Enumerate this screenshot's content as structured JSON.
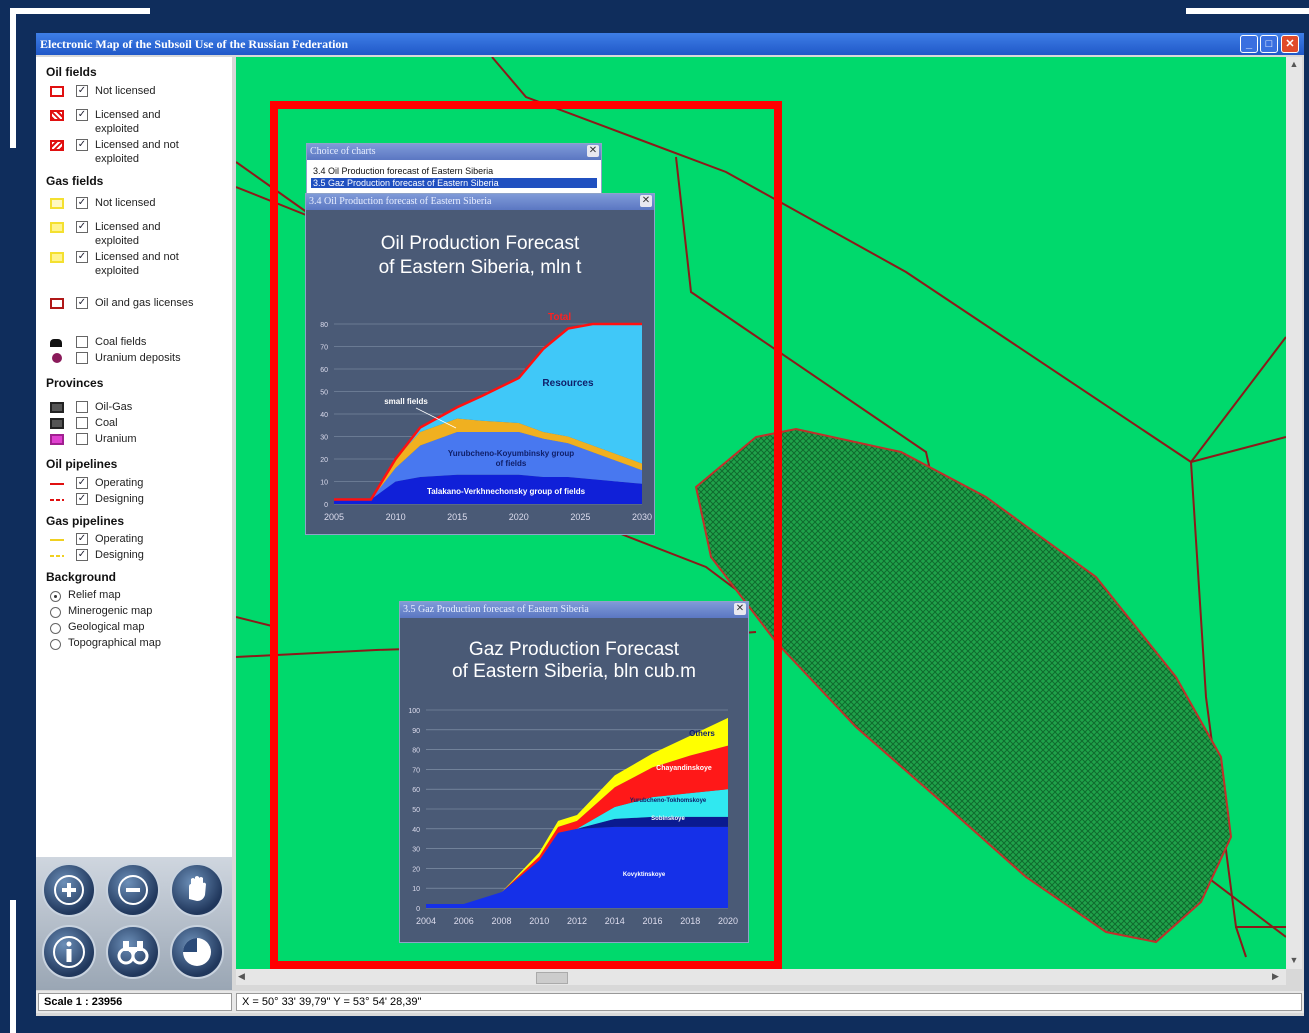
{
  "window": {
    "title": "Electronic Map of the Subsoil Use of the Russian Federation"
  },
  "legend": {
    "oil_fields": {
      "title": "Oil fields",
      "items": [
        "Not licensed",
        "Licensed  and exploited",
        "Licensed  and not exploited"
      ]
    },
    "gas_fields": {
      "title": "Gas fields",
      "items": [
        "Not licensed",
        "Licensed and exploited",
        "Licensed and not exploited"
      ]
    },
    "licenses": {
      "label": "Oil and gas licenses"
    },
    "other": {
      "coal": "Coal fields",
      "uranium": "Uranium deposits"
    },
    "provinces": {
      "title": "Provinces",
      "items": [
        "Oil-Gas",
        "Coal",
        "Uranium"
      ]
    },
    "oil_pipelines": {
      "title": "Oil pipelines",
      "items": [
        "Operating",
        "Designing"
      ]
    },
    "gas_pipelines": {
      "title": "Gas pipelines",
      "items": [
        "Operating",
        "Designing"
      ]
    },
    "background": {
      "title": "Background",
      "options": [
        "Relief map",
        "Minerogenic map",
        "Geological map",
        "Topographical map"
      ],
      "selected": "Relief map"
    }
  },
  "colors": {
    "map_bg": "#00d96c",
    "highlight": "#ff0000",
    "pipeline": "#8b1a1a",
    "chart_bg": "#4a5a76"
  },
  "choice": {
    "title": "Choice of charts",
    "items": [
      "3.4 Oil Production forecast of Eastern Siberia",
      "3.5 Gaz Production forecast of Eastern Siberia"
    ],
    "selected": "3.5 Gaz Production forecast of Eastern Siberia"
  },
  "oil_window": {
    "title": "3.4 Oil Production forecast of Eastern Siberia"
  },
  "gas_window": {
    "title": "3.5 Gaz Production forecast of Eastern Siberia"
  },
  "chart_data": [
    {
      "type": "area",
      "title": "Oil Production Forecast of Eastern Siberia, mln t",
      "title_lines": [
        "Oil Production Forecast",
        "of Eastern Siberia, mln t"
      ],
      "ylim": [
        0,
        80
      ],
      "yticks": [
        0,
        10,
        20,
        30,
        40,
        50,
        60,
        70,
        80
      ],
      "xlim": [
        2005,
        2030
      ],
      "xticks": [
        2005,
        2010,
        2015,
        2020,
        2025,
        2030
      ],
      "x": [
        2005,
        2008,
        2010,
        2012,
        2015,
        2017,
        2020,
        2022,
        2024,
        2026,
        2028,
        2030
      ],
      "series": [
        {
          "name": "Talakano-Verkhnechonsky group of fields",
          "values": [
            2,
            2,
            10,
            12,
            13,
            13,
            13,
            12,
            12,
            11,
            10,
            9
          ]
        },
        {
          "name": "Yurubcheno-Koyumbinsky group of fields",
          "values": [
            0,
            0,
            6,
            14,
            19,
            19,
            19,
            17,
            15,
            12,
            9,
            6
          ]
        },
        {
          "name": "small fields",
          "values": [
            0,
            0,
            4,
            6,
            6,
            5,
            4,
            3,
            3,
            3,
            3,
            3
          ]
        },
        {
          "name": "Resources",
          "values": [
            0,
            0,
            0,
            2,
            5,
            11,
            20,
            37,
            48,
            54,
            58,
            62
          ]
        }
      ],
      "total_label": "Total"
    },
    {
      "type": "area",
      "title": "Gaz Production Forecast of Eastern Siberia, bln cub.m",
      "title_lines": [
        "Gaz Production Forecast",
        "of Eastern Siberia, bln cub.m"
      ],
      "ylim": [
        0,
        100
      ],
      "yticks": [
        0,
        10,
        20,
        30,
        40,
        50,
        60,
        70,
        80,
        90,
        100
      ],
      "xlim": [
        2004,
        2020
      ],
      "xticks": [
        2004,
        2006,
        2008,
        2010,
        2012,
        2014,
        2016,
        2018,
        2020
      ],
      "x": [
        2004,
        2006,
        2008,
        2010,
        2011,
        2012,
        2014,
        2016,
        2018,
        2020
      ],
      "series": [
        {
          "name": "Kovyktinskoye",
          "values": [
            2,
            2,
            8,
            24,
            38,
            40,
            41,
            41,
            41,
            41
          ]
        },
        {
          "name": "Sobinskoye",
          "values": [
            0,
            0,
            0,
            0,
            0,
            0,
            4,
            5,
            5,
            5
          ]
        },
        {
          "name": "Yurubcheno-Tokhomskoye",
          "values": [
            0,
            0,
            0,
            0,
            0,
            0,
            6,
            10,
            12,
            14
          ]
        },
        {
          "name": "Chayandinskoye",
          "values": [
            0,
            0,
            0,
            2,
            3,
            4,
            10,
            15,
            19,
            22
          ]
        },
        {
          "name": "Others",
          "values": [
            0,
            0,
            0,
            2,
            3,
            3,
            6,
            7,
            10,
            14
          ]
        }
      ]
    }
  ],
  "status": {
    "scale": "Scale 1 : 23956",
    "coords": "X = 50° 33' 39,79\"   Y = 53° 54' 28,39\""
  }
}
